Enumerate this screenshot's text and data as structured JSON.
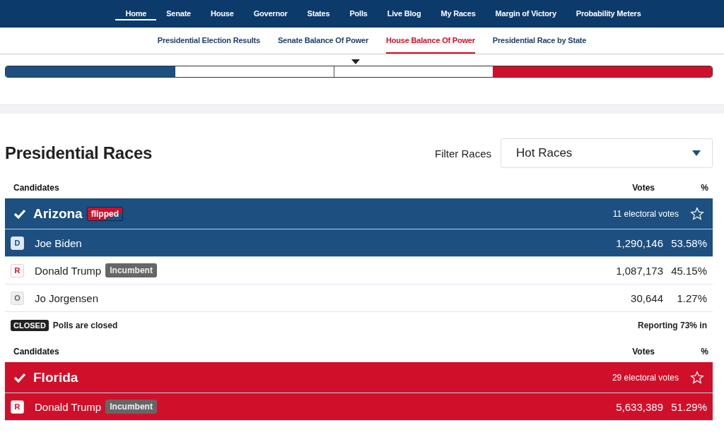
{
  "nav": [
    {
      "label": "Home",
      "selected": true
    },
    {
      "label": "Senate",
      "selected": false
    },
    {
      "label": "House",
      "selected": false
    },
    {
      "label": "Governor",
      "selected": false
    },
    {
      "label": "States",
      "selected": false
    },
    {
      "label": "Polls",
      "selected": false
    },
    {
      "label": "Live Blog",
      "selected": false
    },
    {
      "label": "My Races",
      "selected": false
    },
    {
      "label": "Margin of Victory",
      "selected": false
    },
    {
      "label": "Probability Meters",
      "selected": false
    }
  ],
  "subnav": [
    {
      "label": "Presidential Election Results",
      "selected": false
    },
    {
      "label": "Senate Balance Of Power",
      "selected": false
    },
    {
      "label": "House Balance Of Power",
      "selected": true
    },
    {
      "label": "Presidential Race by State",
      "selected": false
    }
  ],
  "balance": {
    "dem": {
      "level": 0.24
    },
    "rep": {
      "level": 0.31
    }
  },
  "section": {
    "title": "Presidential Races",
    "filter_label": "Filter Races",
    "filter_value": "Hot Races"
  },
  "races": [
    {
      "columns": [
        "Candidates",
        "Votes",
        "%"
      ],
      "state": "Arizona",
      "called": true,
      "flipped": true,
      "flipped_label": "flipped",
      "electoral": "11 electoral votes",
      "starred": false,
      "candidates": [
        {
          "party": "D",
          "name": "Joe Biden",
          "incumbent": false,
          "winner": true,
          "votes": "1,290,146",
          "pct": "53.58%"
        },
        {
          "party": "R",
          "name": "Donald Trump",
          "incumbent": true,
          "incumbent_label": "Incumbent",
          "winner": false,
          "votes": "1,087,173",
          "pct": "45.15%"
        },
        {
          "party": "O",
          "name": "Jo Jorgensen",
          "incumbent": false,
          "winner": false,
          "votes": "30,644",
          "pct": "1.27%"
        }
      ],
      "status_badge": "CLOSED",
      "status_text": "Polls are closed",
      "reporting": "Reporting 73% in"
    },
    {
      "columns": [
        "Candidates",
        "Votes",
        "%"
      ],
      "state": "Florida",
      "called": true,
      "flipped": false,
      "electoral": "29 electoral votes",
      "starred": false,
      "candidates": [
        {
          "party": "R",
          "name": "Donald Trump",
          "incumbent": true,
          "incumbent_label": "Incumbent",
          "winner": true,
          "votes": "5,633,389",
          "pct": "51.29%"
        }
      ]
    }
  ]
}
